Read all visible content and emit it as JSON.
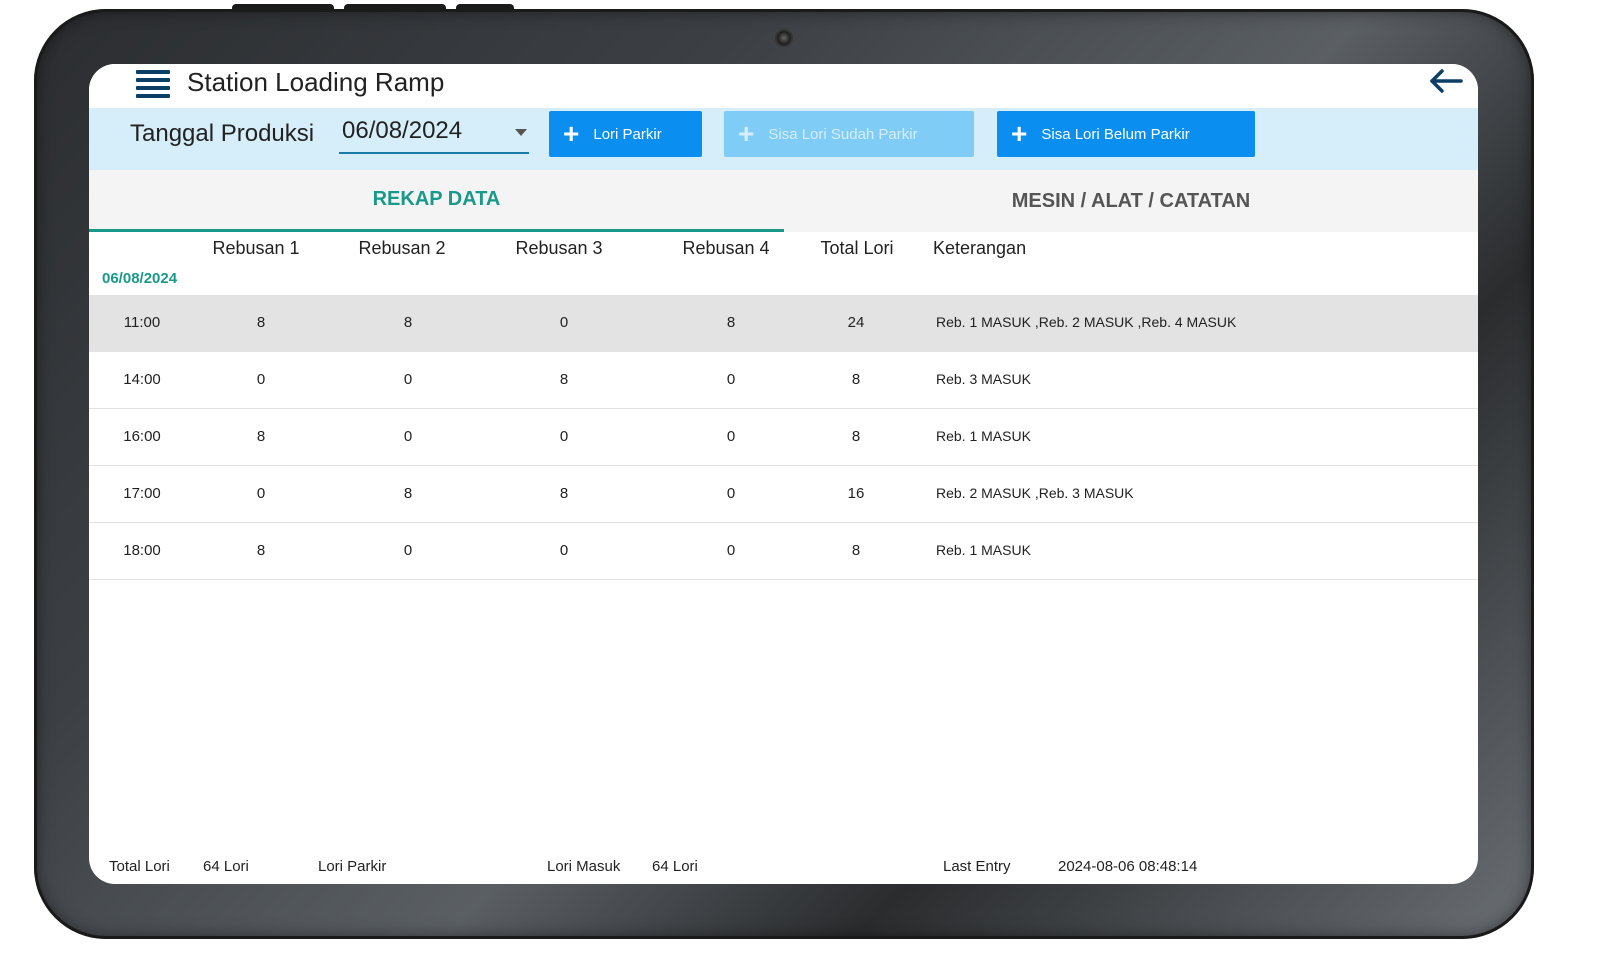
{
  "app": {
    "title": "Station Loading Ramp"
  },
  "filter": {
    "label": "Tanggal Produksi",
    "date_value": "06/08/2024",
    "buttons": {
      "lori_parkir": "Lori Parkir",
      "sisa_sudah_parkir": "Sisa Lori Sudah Parkir",
      "sisa_belum_parkir": "Sisa Lori Belum Parkir"
    }
  },
  "tabs": {
    "rekap": "REKAP DATA",
    "mesin": "MESIN / ALAT / CATATAN"
  },
  "table": {
    "headers": [
      "Rebusan 1",
      "Rebusan 2",
      "Rebusan 3",
      "Rebusan 4",
      "Total Lori",
      "Keterangan"
    ],
    "date_group": "06/08/2024",
    "rows": [
      {
        "time": "11:00",
        "r1": "8",
        "r2": "8",
        "r3": "0",
        "r4": "8",
        "total": "24",
        "keterangan": "Reb. 1 MASUK ,Reb. 2 MASUK ,Reb. 4 MASUK"
      },
      {
        "time": "14:00",
        "r1": "0",
        "r2": "0",
        "r3": "8",
        "r4": "0",
        "total": "8",
        "keterangan": "Reb. 3 MASUK"
      },
      {
        "time": "16:00",
        "r1": "8",
        "r2": "0",
        "r3": "0",
        "r4": "0",
        "total": "8",
        "keterangan": "Reb. 1 MASUK"
      },
      {
        "time": "17:00",
        "r1": "0",
        "r2": "8",
        "r3": "8",
        "r4": "0",
        "total": "16",
        "keterangan": "Reb. 2 MASUK ,Reb. 3 MASUK"
      },
      {
        "time": "18:00",
        "r1": "8",
        "r2": "0",
        "r3": "0",
        "r4": "0",
        "total": "8",
        "keterangan": "Reb. 1 MASUK"
      }
    ]
  },
  "footer": {
    "total_lori_label": "Total Lori",
    "total_lori_value": "64 Lori",
    "lori_parkir_label": "Lori Parkir",
    "lori_masuk_label": "Lori Masuk",
    "lori_masuk_value": "64 Lori",
    "last_entry_label": "Last Entry",
    "last_entry_value": "2024-08-06 08:48:14"
  },
  "colors": {
    "accent_teal": "#19998a",
    "button_blue": "#0a8ef0",
    "button_disabled": "#7fccf6",
    "filter_bg": "#d6eef9",
    "nav_dark": "#0b3f66"
  },
  "icons": {
    "menu": "hamburger-menu-icon",
    "back": "arrow-left-icon",
    "add": "plus-icon",
    "dropdown": "caret-down-icon"
  }
}
